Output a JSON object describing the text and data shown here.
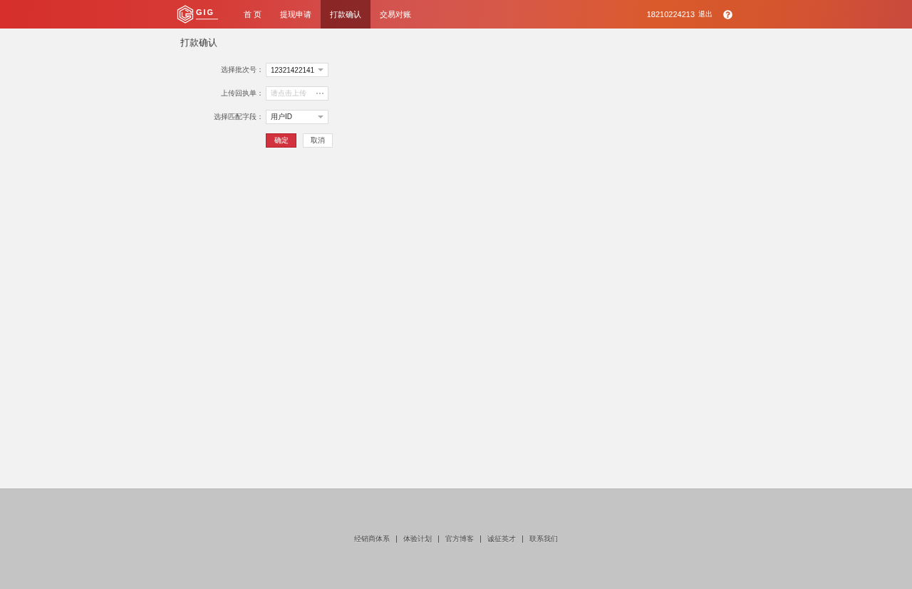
{
  "header": {
    "logo": {
      "text": "GIG"
    },
    "nav": [
      {
        "label": "首 页",
        "selected": false
      },
      {
        "label": "提现申请",
        "selected": false
      },
      {
        "label": "打款确认",
        "selected": true
      },
      {
        "label": "交易对账",
        "selected": false
      }
    ],
    "user": {
      "phone": "18210224213",
      "logout": "退出"
    }
  },
  "page": {
    "title": "打款确认",
    "form": {
      "fields": [
        {
          "kind": "select",
          "label": "选择批次号：",
          "value": "12321422141"
        },
        {
          "kind": "upload",
          "label": "上传回执单：",
          "placeholder": "请点击上传"
        },
        {
          "kind": "select",
          "label": "选择匹配字段：",
          "value": "用户ID"
        }
      ],
      "buttons": [
        {
          "kind": "primary",
          "label": "确定"
        },
        {
          "kind": "secondary",
          "label": "取消"
        }
      ]
    }
  },
  "footer": {
    "links": [
      "经销商体系",
      "体验计划",
      "官方博客",
      "诚征英才",
      "联系我们"
    ]
  }
}
